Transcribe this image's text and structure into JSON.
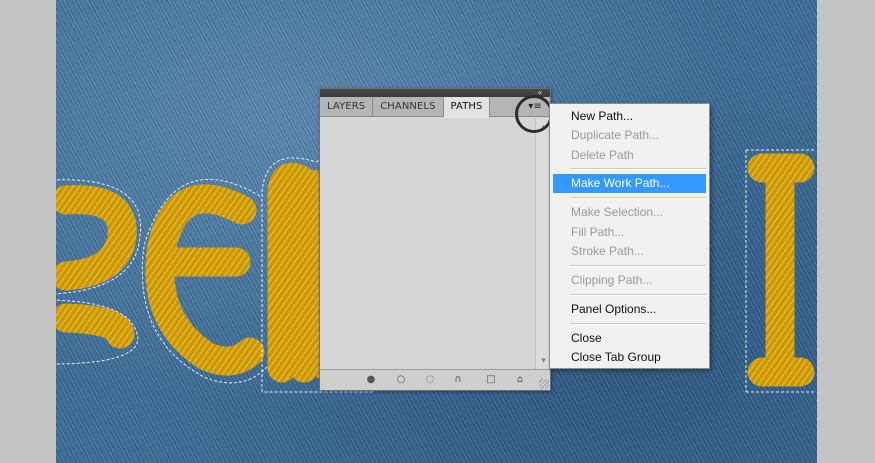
{
  "panel": {
    "tabs": [
      {
        "label": "LAYERS",
        "active": false
      },
      {
        "label": "CHANNELS",
        "active": false
      },
      {
        "label": "PATHS",
        "active": true
      }
    ],
    "collapse_glyph": "«",
    "menu_button_glyph": "▾≡",
    "footer_icons": [
      {
        "name": "fill-path-icon",
        "glyph": "●"
      },
      {
        "name": "stroke-path-icon",
        "glyph": "○"
      },
      {
        "name": "load-as-selection-icon",
        "glyph": "◌"
      },
      {
        "name": "make-work-path-icon",
        "glyph": "∩"
      },
      {
        "name": "new-path-icon",
        "glyph": "□"
      },
      {
        "name": "delete-path-icon",
        "glyph": "⌂"
      }
    ],
    "scroll_up": "▴",
    "scroll_down": "▾"
  },
  "menu": {
    "items": [
      {
        "label": "New Path...",
        "state": "enabled"
      },
      {
        "label": "Duplicate Path...",
        "state": "disabled"
      },
      {
        "label": "Delete Path",
        "state": "disabled"
      },
      {
        "label": "Make Work Path...",
        "state": "selected"
      },
      {
        "label": "Make Selection...",
        "state": "disabled"
      },
      {
        "label": "Fill Path...",
        "state": "disabled"
      },
      {
        "label": "Stroke Path...",
        "state": "disabled"
      },
      {
        "label": "Clipping Path...",
        "state": "disabled"
      },
      {
        "label": "Panel Options...",
        "state": "enabled"
      },
      {
        "label": "Close",
        "state": "enabled"
      },
      {
        "label": "Close Tab Group",
        "state": "enabled"
      }
    ]
  },
  "colors": {
    "denim": "#3f6f99",
    "gold_text": "#c8940a",
    "menu_highlight": "#3399ff"
  }
}
